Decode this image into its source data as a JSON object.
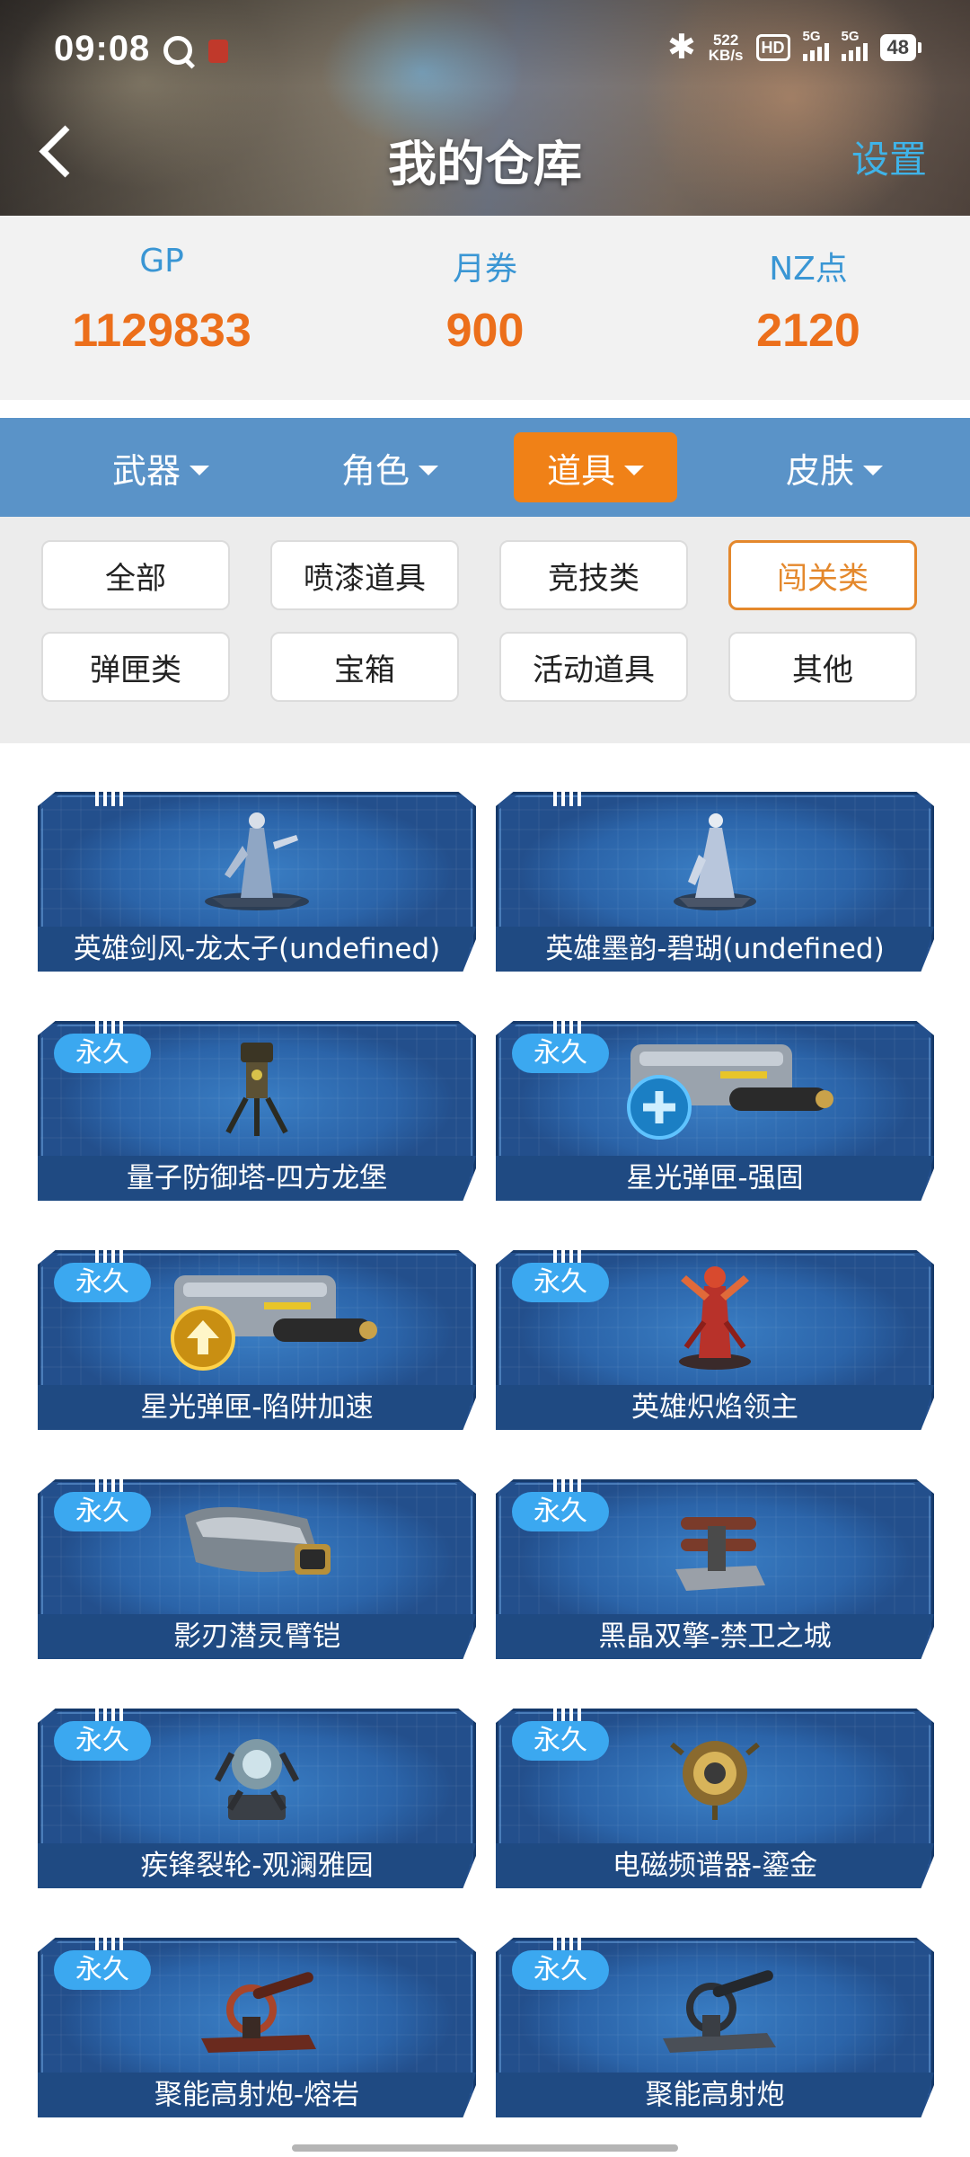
{
  "status_bar": {
    "time": "09:08",
    "net_speed_value": "522",
    "net_speed_unit": "KB/s",
    "hd_label": "HD",
    "sim1": "1",
    "sim2": "2",
    "network1": "5G",
    "network2": "5G",
    "battery": "48"
  },
  "header": {
    "title": "我的仓库",
    "settings_label": "设置"
  },
  "currencies": [
    {
      "label": "GP",
      "value": "1129833"
    },
    {
      "label": "月券",
      "value": "900"
    },
    {
      "label": "NZ点",
      "value": "2120"
    }
  ],
  "tabs": [
    {
      "label": "武器",
      "active": false
    },
    {
      "label": "角色",
      "active": false
    },
    {
      "label": "道具",
      "active": true
    },
    {
      "label": "皮肤",
      "active": false
    }
  ],
  "filters": [
    {
      "label": "全部",
      "active": false
    },
    {
      "label": "喷漆道具",
      "active": false
    },
    {
      "label": "竞技类",
      "active": false
    },
    {
      "label": "闯关类",
      "active": true
    },
    {
      "label": "弹匣类",
      "active": false
    },
    {
      "label": "宝箱",
      "active": false
    },
    {
      "label": "活动道具",
      "active": false
    },
    {
      "label": "其他",
      "active": false
    }
  ],
  "items": [
    {
      "name": "英雄剑风-龙太子(undefined)",
      "badge": "",
      "icon": "hero-statue-icon"
    },
    {
      "name": "英雄墨韵-碧瑚(undefined)",
      "badge": "",
      "icon": "hero-statue-icon"
    },
    {
      "name": "量子防御塔-四方龙堡",
      "badge": "永久",
      "icon": "defense-tower-icon"
    },
    {
      "name": "星光弹匣-强固",
      "badge": "永久",
      "icon": "magazine-plus-icon"
    },
    {
      "name": "星光弹匣-陷阱加速",
      "badge": "永久",
      "icon": "magazine-up-icon"
    },
    {
      "name": "英雄炽焰领主",
      "badge": "永久",
      "icon": "fire-lord-icon"
    },
    {
      "name": "影刃潜灵臂铠",
      "badge": "永久",
      "icon": "arm-armor-icon"
    },
    {
      "name": "黑晶双擎-禁卫之城",
      "badge": "永久",
      "icon": "twin-engine-icon"
    },
    {
      "name": "疾锋裂轮-观澜雅园",
      "badge": "永久",
      "icon": "blade-wheel-icon"
    },
    {
      "name": "电磁频谱器-鎏金",
      "badge": "永久",
      "icon": "spectrum-device-icon"
    },
    {
      "name": "聚能高射炮-熔岩",
      "badge": "永久",
      "icon": "flak-cannon-icon"
    },
    {
      "name": "聚能高射炮",
      "badge": "永久",
      "icon": "flak-cannon-icon"
    }
  ],
  "colors": {
    "accent_orange": "#f08117",
    "currency_label_blue": "#3a96d4",
    "tab_bar_blue": "#5a93c8",
    "card_blue": "#2b64a9",
    "badge_blue": "#3ba8f0"
  }
}
